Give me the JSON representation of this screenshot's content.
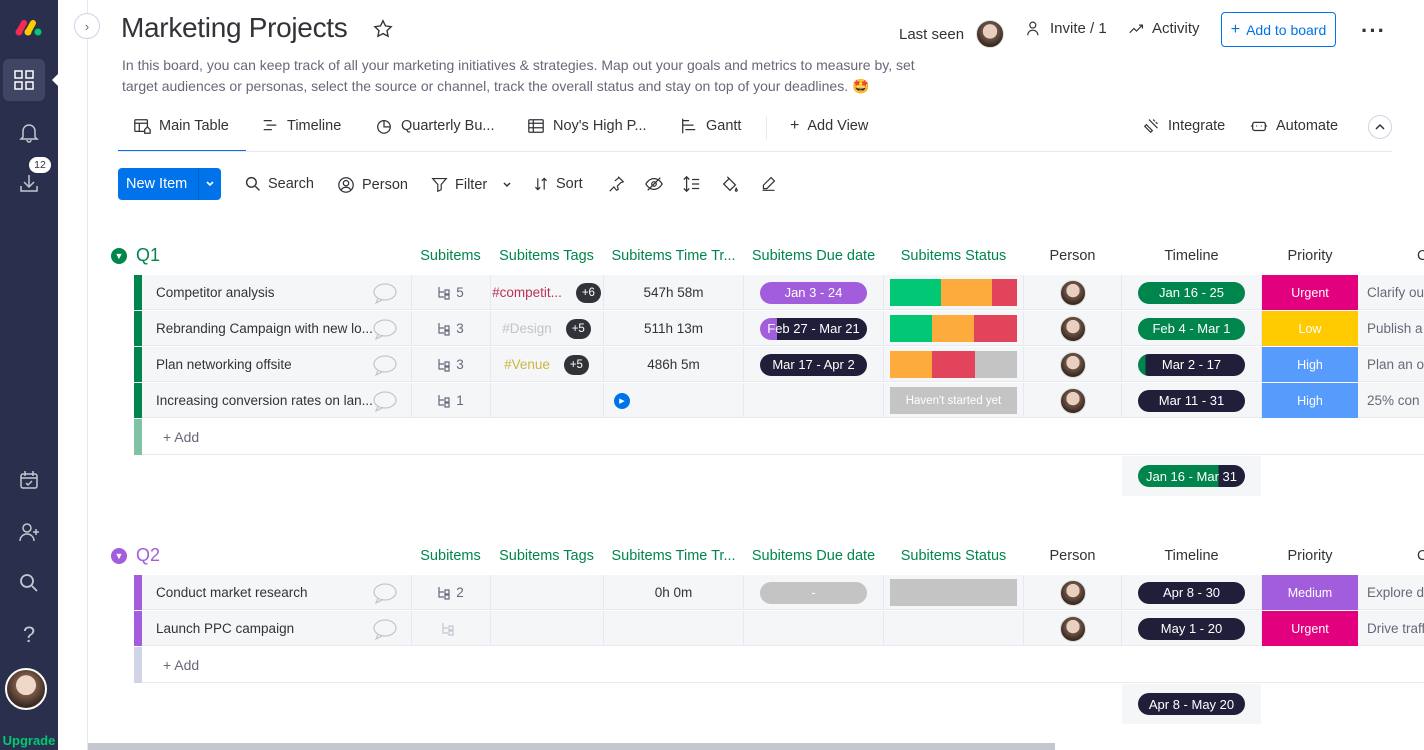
{
  "leftbar": {
    "notifications_badge": "12",
    "upgrade_label": "Upgrade"
  },
  "header": {
    "title": "Marketing Projects",
    "description": "In this board, you can keep track of all your marketing initiatives & strategies. Map out your goals and metrics to measure by, set target audiences or personas, select the source or channel, track the overall status and stay on top of your deadlines. 🤩",
    "last_seen": "Last seen",
    "invite": "Invite / 1",
    "activity": "Activity",
    "add_to_board": "Add to board"
  },
  "tabs": [
    {
      "label": "Main Table"
    },
    {
      "label": "Timeline"
    },
    {
      "label": "Quarterly Bu..."
    },
    {
      "label": "Noy's High P..."
    },
    {
      "label": "Gantt"
    },
    {
      "label": "Add View"
    }
  ],
  "tabs_right": {
    "integrate": "Integrate",
    "automate": "Automate"
  },
  "toolbar": {
    "new_item": "New Item",
    "search": "Search",
    "person": "Person",
    "filter": "Filter",
    "sort": "Sort"
  },
  "columns": [
    "Subitems",
    "Subitems Tags",
    "Subitems Time Tr...",
    "Subitems Due date",
    "Subitems Status",
    "Person",
    "Timeline",
    "Priority"
  ],
  "colors": {
    "q1": "#00854d",
    "q2": "#a25ddc",
    "blue": "#0073ea",
    "urgent": "#e2007e",
    "low": "#ffcb00",
    "high": "#579bfc",
    "medium": "#a25ddc"
  },
  "groups": [
    {
      "name": "Q1",
      "add_label": "+ Add",
      "timeline_summary": "Jan 16 - Mar 31",
      "rows": [
        {
          "name": "Competitor analysis",
          "subitems": "5",
          "tag": "#competit...",
          "tag_more": "+6",
          "time": "547h 58m",
          "due": "Jan 3 - 24",
          "timeline": "Jan 16 - 25",
          "priority": "Urgent",
          "note": "Clarify ou"
        },
        {
          "name": "Rebranding Campaign with new lo...",
          "subitems": "3",
          "tag": "#Design",
          "tag_more": "+5",
          "time": "511h 13m",
          "due": "Feb 27 - Mar 21",
          "timeline": "Feb 4 - Mar 1",
          "priority": "Low",
          "note": "Publish a"
        },
        {
          "name": "Plan networking offsite",
          "subitems": "3",
          "tag": "#Venue",
          "tag_more": "+5",
          "time": "486h 5m",
          "due": "Mar 17 - Apr 2",
          "timeline": "Mar 2 - 17",
          "priority": "High",
          "note": "Plan an o"
        },
        {
          "name": "Increasing conversion rates on lan...",
          "subitems": "1",
          "tag": "",
          "tag_more": "",
          "time": "",
          "due": "",
          "status_text": "Haven't started yet",
          "timeline": "Mar 11 - 31",
          "priority": "High",
          "note": "25% con"
        }
      ]
    },
    {
      "name": "Q2",
      "add_label": "+ Add",
      "timeline_summary": "Apr 8 - May 20",
      "rows": [
        {
          "name": "Conduct market research",
          "subitems": "2",
          "time": "0h 0m",
          "due": "-",
          "timeline": "Apr 8 - 30",
          "priority": "Medium",
          "note": "Explore de"
        },
        {
          "name": "Launch PPC campaign",
          "subitems": "",
          "time": "",
          "due": "",
          "timeline": "May 1 - 20",
          "priority": "Urgent",
          "note": "Drive traff"
        }
      ]
    }
  ]
}
